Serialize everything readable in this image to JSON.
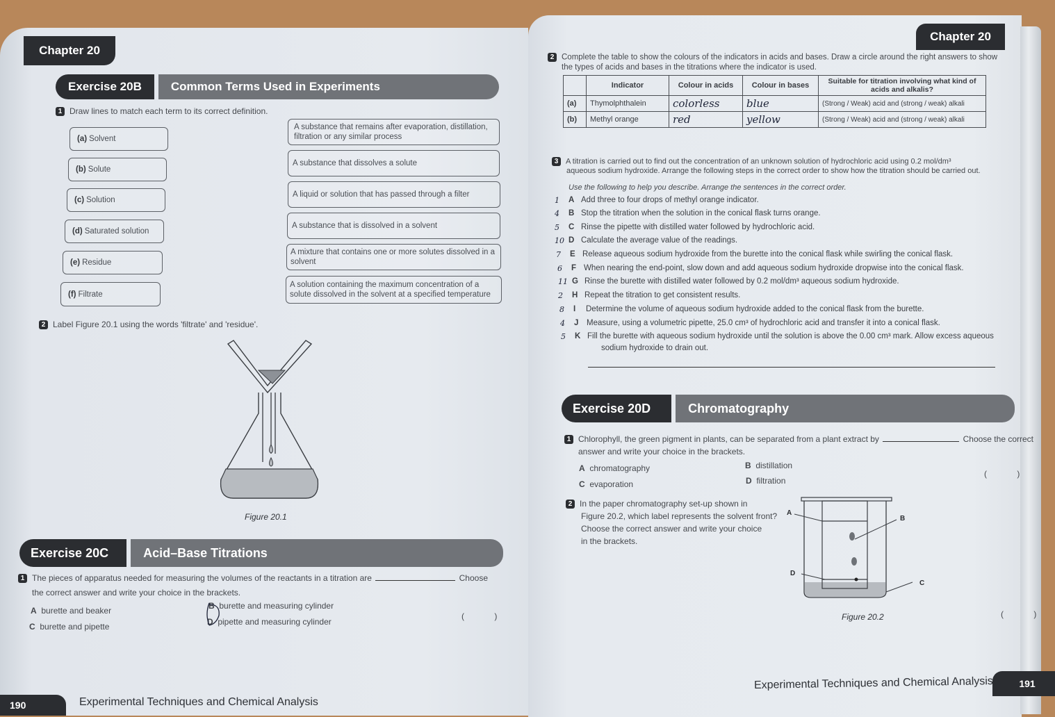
{
  "left_page": {
    "chapter": "Chapter 20",
    "exercise_20b": {
      "number": "Exercise 20B",
      "title": "Common Terms Used in Experiments",
      "q1": {
        "num": "1",
        "prompt": "Draw lines to match each term to its correct definition.",
        "terms": [
          {
            "letter": "(a)",
            "label": "Solvent"
          },
          {
            "letter": "(b)",
            "label": "Solute"
          },
          {
            "letter": "(c)",
            "label": "Solution"
          },
          {
            "letter": "(d)",
            "label": "Saturated solution"
          },
          {
            "letter": "(e)",
            "label": "Residue"
          },
          {
            "letter": "(f)",
            "label": "Filtrate"
          }
        ],
        "definitions": [
          "A substance that remains after evaporation, distillation, filtration or any similar process",
          "A substance that dissolves a solute",
          "A liquid or solution that has passed through a filter",
          "A substance that is dissolved in a solvent",
          "A mixture that contains one or more solutes dissolved in a solvent",
          "A solution containing the maximum concentration of a solute dissolved in the solvent at a specified temperature"
        ]
      },
      "q2": {
        "num": "2",
        "prompt": "Label Figure 20.1 using the words 'filtrate' and 'residue'.",
        "figure_caption": "Figure 20.1"
      }
    },
    "exercise_20c": {
      "number": "Exercise 20C",
      "title": "Acid–Base Titrations",
      "q1": {
        "num": "1",
        "prompt_line1": "The pieces of apparatus needed for measuring the volumes of the reactants in a titration are",
        "prompt_choose": "Choose",
        "prompt_line2": "the correct answer and write your choice in the brackets.",
        "options": [
          {
            "letter": "A",
            "text": "burette and beaker"
          },
          {
            "letter": "B",
            "text": "burette and measuring cylinder"
          },
          {
            "letter": "C",
            "text": "burette and pipette"
          },
          {
            "letter": "D",
            "text": "pipette and measuring cylinder"
          }
        ],
        "brackets": "(  )"
      }
    },
    "footer": {
      "page_number": "190",
      "title": "Experimental Techniques and Chemical Analysis"
    }
  },
  "right_page": {
    "chapter": "Chapter 20",
    "q2": {
      "num": "2",
      "prompt_line1": "Complete the table to show the colours of the indicators in acids and bases. Draw a circle around the right answers to show",
      "prompt_line2": "the types of acids and bases in the titrations where the indicator is used.",
      "table": {
        "headers": [
          "",
          "Indicator",
          "Colour in acids",
          "Colour in bases",
          "Suitable for titration involving what kind of acids and alkalis?"
        ],
        "rows": [
          {
            "label": "(a)",
            "indicator": "Thymolphthalein",
            "acid_colour": "colorless",
            "base_colour": "blue",
            "suitable": "(Strong / Weak) acid and (strong / weak) alkali"
          },
          {
            "label": "(b)",
            "indicator": "Methyl orange",
            "acid_colour": "red",
            "base_colour": "yellow",
            "suitable": "(Strong / Weak) acid and (strong / weak) alkali"
          }
        ]
      }
    },
    "q3": {
      "num": "3",
      "prompt_line1": "A titration is carried out to find out the concentration of an unknown solution of hydrochloric acid using 0.2 mol/dm³",
      "prompt_line2": "aqueous sodium hydroxide. Arrange the following steps in the correct order to show how the titration should be carried out.",
      "instruction": "Use the following to help you describe. Arrange the sentences in the correct order.",
      "steps": [
        {
          "mark": "1",
          "letter": "A",
          "text": "Add three to four drops of methyl orange indicator."
        },
        {
          "mark": "4",
          "letter": "B",
          "text": "Stop the titration when the solution in the conical flask turns orange."
        },
        {
          "mark": "5",
          "letter": "C",
          "text": "Rinse the pipette with distilled water followed by hydrochloric acid."
        },
        {
          "mark": "10",
          "letter": "D",
          "text": "Calculate the average value of the readings."
        },
        {
          "mark": "7",
          "letter": "E",
          "text": "Release aqueous sodium hydroxide from the burette into the conical flask while swirling the conical flask."
        },
        {
          "mark": "6",
          "letter": "F",
          "text": "When nearing the end-point, slow down and add aqueous sodium hydroxide dropwise into the conical flask."
        },
        {
          "mark": "11",
          "letter": "G",
          "text": "Rinse the burette with distilled water followed by 0.2 mol/dm³ aqueous sodium hydroxide."
        },
        {
          "mark": "2",
          "letter": "H",
          "text": "Repeat the titration to get consistent results."
        },
        {
          "mark": "8",
          "letter": "I",
          "text": "Determine the volume of aqueous sodium hydroxide added to the conical flask from the burette."
        },
        {
          "mark": "4",
          "letter": "J",
          "text": "Measure, using a volumetric pipette, 25.0 cm³ of hydrochloric acid and transfer it into a conical flask."
        },
        {
          "mark": "5",
          "letter": "K",
          "text": "Fill the burette with aqueous sodium hydroxide until the solution is above the 0.00 cm³ mark. Allow excess aqueous"
        },
        {
          "mark": "",
          "letter": "",
          "text": "sodium hydroxide to drain out."
        }
      ]
    },
    "exercise_20d": {
      "number": "Exercise 20D",
      "title": "Chromatography",
      "q1": {
        "num": "1",
        "prompt_line1": "Chlorophyll, the green pigment in plants, can be separated from a plant extract by",
        "prompt_choose": "Choose the correct",
        "prompt_line2": "answer and write your choice in the brackets.",
        "options": [
          {
            "letter": "A",
            "text": "chromatography"
          },
          {
            "letter": "B",
            "text": "distillation"
          },
          {
            "letter": "C",
            "text": "evaporation"
          },
          {
            "letter": "D",
            "text": "filtration"
          }
        ],
        "brackets": "(  )"
      },
      "q2": {
        "num": "2",
        "prompt_lines": [
          "In the paper chromatography set-up shown in",
          "Figure 20.2, which label represents the solvent front?",
          "Choose the correct answer and write your choice",
          "in the brackets."
        ],
        "figure_labels": [
          "A",
          "B",
          "C",
          "D"
        ],
        "figure_caption": "Figure 20.2",
        "brackets": "(  )"
      }
    },
    "footer": {
      "page_number": "191",
      "title": "Experimental Techniques and Chemical Analysis"
    }
  }
}
